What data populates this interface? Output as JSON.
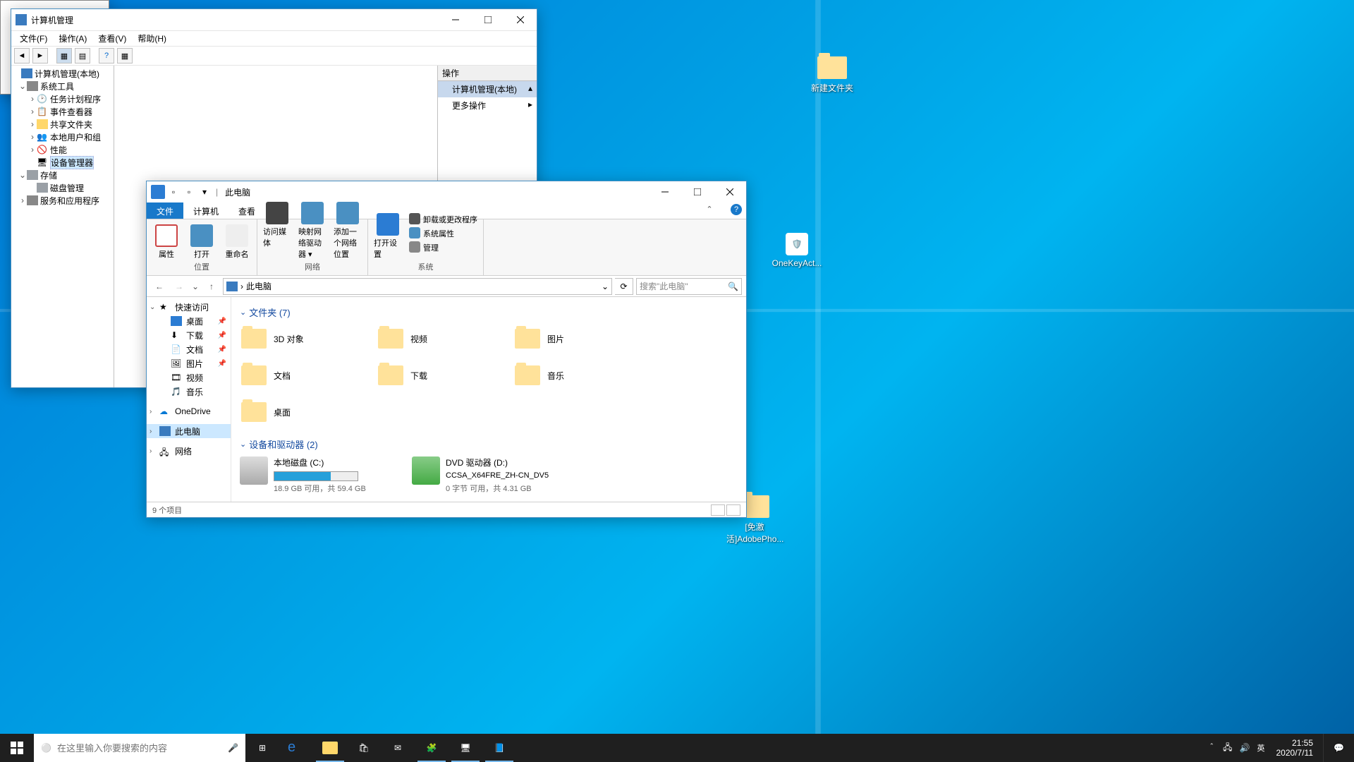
{
  "desktop": {
    "icons": [
      {
        "label": "新建文件夹"
      },
      {
        "label": "OneKeyAct..."
      },
      {
        "label": "[免激活]AdobePho..."
      }
    ]
  },
  "compmgmt": {
    "title": "计算机管理",
    "menu": [
      "文件(F)",
      "操作(A)",
      "查看(V)",
      "帮助(H)"
    ],
    "tree": {
      "root": "计算机管理(本地)",
      "system_tools": "系统工具",
      "task_scheduler": "任务计划程序",
      "event_viewer": "事件查看器",
      "shared_folders": "共享文件夹",
      "local_users": "本地用户和组",
      "performance": "性能",
      "device_manager": "设备管理器",
      "storage": "存储",
      "disk_mgmt": "磁盘管理",
      "services_apps": "服务和应用程序"
    },
    "actions": {
      "header": "操作",
      "item1": "计算机管理(本地)",
      "item2": "更多操作"
    }
  },
  "explorer": {
    "title": "此电脑",
    "tabs": {
      "file": "文件",
      "computer": "计算机",
      "view": "查看"
    },
    "ribbon": {
      "properties": "属性",
      "open": "打开",
      "rename": "重命名",
      "access_media": "访问媒体",
      "map_drive": "映射网络驱动器 ▾",
      "add_network": "添加一个网络位置",
      "open_settings": "打开设置",
      "uninstall": "卸载或更改程序",
      "sys_props": "系统属性",
      "manage": "管理",
      "grp_location": "位置",
      "grp_network": "网络",
      "grp_system": "系统"
    },
    "address": "此电脑",
    "search_placeholder": "搜索\"此电脑\"",
    "nav": {
      "quick": "快速访问",
      "desktop": "桌面",
      "downloads": "下载",
      "documents": "文档",
      "pictures": "图片",
      "videos": "视频",
      "music": "音乐",
      "onedrive": "OneDrive",
      "thispc": "此电脑",
      "network": "网络"
    },
    "groups": {
      "folders": "文件夹 (7)",
      "devices": "设备和驱动器 (2)"
    },
    "folders": [
      {
        "name": "3D 对象"
      },
      {
        "name": "视频"
      },
      {
        "name": "图片"
      },
      {
        "name": "文档"
      },
      {
        "name": "下载"
      },
      {
        "name": "音乐"
      },
      {
        "name": "桌面"
      }
    ],
    "drives": [
      {
        "name": "本地磁盘 (C:)",
        "free_text": "18.9 GB 可用，共 59.4 GB",
        "fill_pct": 68
      },
      {
        "name": "DVD 驱动器 (D:)",
        "subtitle": "CCSA_X64FRE_ZH-CN_DV5",
        "free_text": "0 字节 可用，共 4.31 GB"
      }
    ],
    "status": "9 个项目"
  },
  "taskbar": {
    "search_placeholder": "在这里输入你要搜索的内容",
    "ime": "英",
    "time": "21:55",
    "date": "2020/7/11"
  }
}
